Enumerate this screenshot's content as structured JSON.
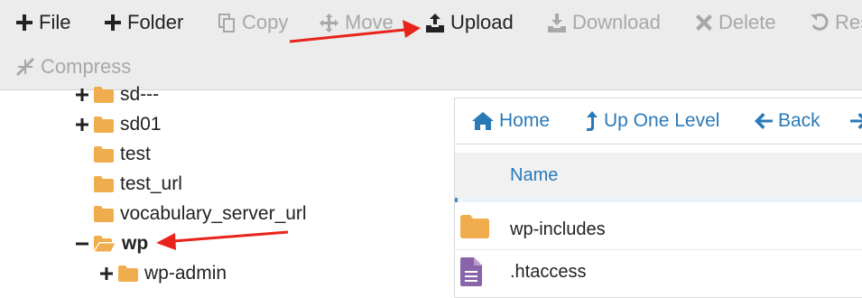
{
  "toolbar": {
    "file_label": "File",
    "folder_label": "Folder",
    "copy_label": "Copy",
    "move_label": "Move",
    "upload_label": "Upload",
    "download_label": "Download",
    "delete_label": "Delete",
    "restore_label": "Res",
    "compress_label": "Compress"
  },
  "tree": {
    "items": [
      {
        "label": "sd---",
        "expander": "+"
      },
      {
        "label": "sd01",
        "expander": "+"
      },
      {
        "label": "test",
        "expander": ""
      },
      {
        "label": "test_url",
        "expander": ""
      },
      {
        "label": "vocabulary_server_url",
        "expander": ""
      },
      {
        "label": "wp",
        "expander": "−"
      },
      {
        "label": "wp-admin",
        "expander": "+"
      }
    ]
  },
  "nav": {
    "home_label": "Home",
    "up_label": "Up One Level",
    "back_label": "Back"
  },
  "file_list": {
    "column_name": "Name",
    "rows": [
      {
        "name": "wp-includes",
        "icon": "folder-icon"
      },
      {
        "name": ".htaccess",
        "icon": "text-file-icon"
      }
    ]
  },
  "colors": {
    "folder": "#f0ad4e",
    "link": "#2a7ab8",
    "annotation_arrow": "#e8231b"
  }
}
